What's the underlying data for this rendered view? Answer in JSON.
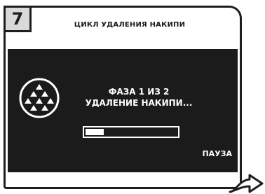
{
  "step": {
    "number": "7"
  },
  "header": {
    "title": "ЦИКЛ УДАЛЕНИЯ НАКИПИ"
  },
  "display": {
    "icon": "descale-icon",
    "phase_line1": "ФАЗА 1 ИЗ 2",
    "phase_line2": "УДАЛЕНИЕ НАКИПИ...",
    "progress": 0.2,
    "pause_label": "ПАУЗА"
  },
  "footer": {
    "icon": "next-page-arrow-icon"
  },
  "colors": {
    "screen_bg": "#1b1b1b",
    "screen_text": "#ffffff",
    "frame": "#1e1e1e",
    "badge_bg": "#d9d9d9"
  }
}
